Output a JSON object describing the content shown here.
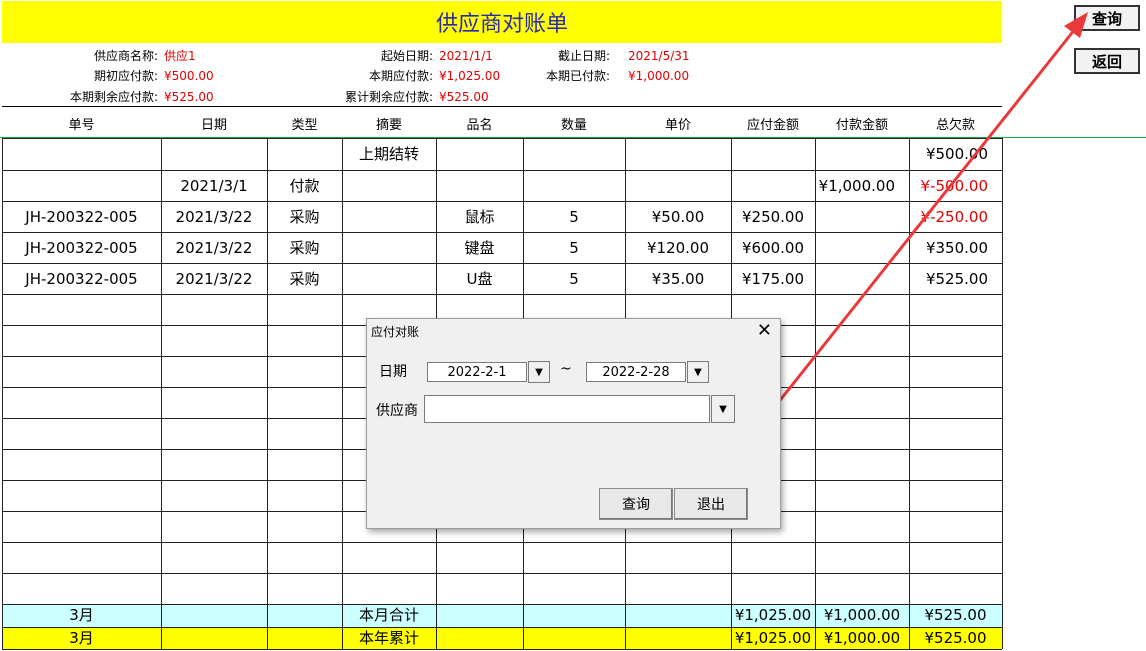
{
  "title": "供应商对账单",
  "side_buttons": {
    "query": "查询",
    "back": "返回"
  },
  "info": {
    "supplier_label": "供应商名称:",
    "supplier_value": "供应1",
    "start_label": "起始日期:",
    "start_value": "2021/1/1",
    "end_label": "截止日期:",
    "end_value": "2021/5/31",
    "opening_label": "期初应付款:",
    "opening_value": "¥500.00",
    "period_payable_label": "本期应付款:",
    "period_payable_value": "¥1,025.00",
    "period_paid_label": "本期已付款:",
    "period_paid_value": "¥1,000.00",
    "period_remaining_label": "本期剩余应付款:",
    "period_remaining_value": "¥525.00",
    "cumulative_label": "累计剩余应付款:",
    "cumulative_value": "¥525.00"
  },
  "columns": [
    "单号",
    "日期",
    "类型",
    "摘要",
    "品名",
    "数量",
    "单价",
    "应付金额",
    "付款金额",
    "总欠款"
  ],
  "rows": [
    {
      "no": "",
      "date": "",
      "type": "",
      "summary": "上期结转",
      "item": "",
      "qty": "",
      "price": "",
      "payable": "",
      "paid": "",
      "balance": "¥500.00",
      "neg": false
    },
    {
      "no": "",
      "date": "2021/3/1",
      "type": "付款",
      "summary": "",
      "item": "",
      "qty": "",
      "price": "",
      "payable": "",
      "paid": "¥1,000.00",
      "balance": "¥-500.00",
      "neg": true
    },
    {
      "no": "JH-200322-005",
      "date": "2021/3/22",
      "type": "采购",
      "summary": "",
      "item": "鼠标",
      "qty": "5",
      "price": "¥50.00",
      "payable": "¥250.00",
      "paid": "",
      "balance": "¥-250.00",
      "neg": true
    },
    {
      "no": "JH-200322-005",
      "date": "2021/3/22",
      "type": "采购",
      "summary": "",
      "item": "键盘",
      "qty": "5",
      "price": "¥120.00",
      "payable": "¥600.00",
      "paid": "",
      "balance": "¥350.00",
      "neg": false
    },
    {
      "no": "JH-200322-005",
      "date": "2021/3/22",
      "type": "采购",
      "summary": "",
      "item": "U盘",
      "qty": "5",
      "price": "¥35.00",
      "payable": "¥175.00",
      "paid": "",
      "balance": "¥525.00",
      "neg": false
    }
  ],
  "totals": [
    {
      "month": "3月",
      "label": "本月合计",
      "payable": "¥1,025.00",
      "paid": "¥1,000.00",
      "balance": "¥525.00",
      "color": "#ccffff"
    },
    {
      "month": "3月",
      "label": "本年累计",
      "payable": "¥1,025.00",
      "paid": "¥1,000.00",
      "balance": "¥525.00",
      "color": "#ffff00"
    }
  ],
  "dialog": {
    "title": "应付对账",
    "close": "✕",
    "date_label": "日期",
    "date_from": "2022-2-1",
    "tilde": "~",
    "date_to": "2022-2-28",
    "supplier_label": "供应商",
    "supplier_value": "",
    "query_btn": "查询",
    "exit_btn": "退出"
  },
  "colors": {
    "title_bg": "#ffff00",
    "title_text": "#2a2ab0",
    "negative": "#e00000",
    "arrow": "#e83a3a"
  }
}
